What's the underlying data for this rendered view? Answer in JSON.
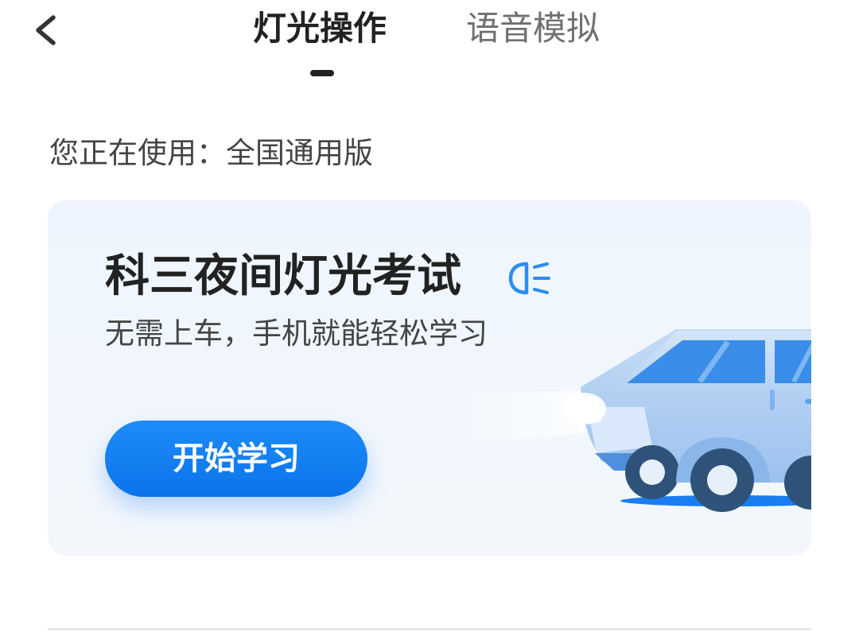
{
  "header": {
    "tabs": [
      {
        "label": "灯光操作",
        "active": true
      },
      {
        "label": "语音模拟",
        "active": false
      }
    ]
  },
  "version": {
    "label": "您正在使用：全国通用版"
  },
  "card": {
    "title": "科三夜间灯光考试",
    "subtitle": "无需上车，手机就能轻松学习",
    "button_label": "开始学习"
  },
  "icons": {
    "back": "chevron-left-icon",
    "headlight": "headlight-icon"
  },
  "colors": {
    "accent": "#0b73ea",
    "card_bg": "#eef5fe",
    "car_blue": "#a8c9f2",
    "wheel_dark": "#2f5279"
  }
}
